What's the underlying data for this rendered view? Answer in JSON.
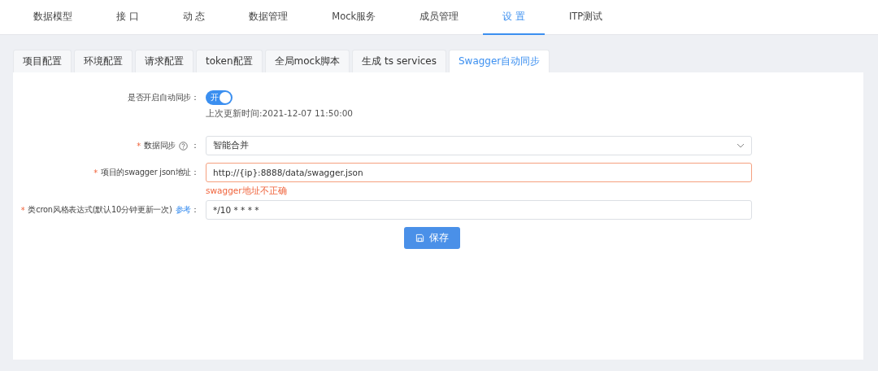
{
  "nav": [
    {
      "label": "数据模型",
      "selected": false
    },
    {
      "label": "接 口",
      "selected": false
    },
    {
      "label": "动 态",
      "selected": false
    },
    {
      "label": "数据管理",
      "selected": false
    },
    {
      "label": "Mock服务",
      "selected": false
    },
    {
      "label": "成员管理",
      "selected": false
    },
    {
      "label": "设 置",
      "selected": true
    },
    {
      "label": "ITP测试",
      "selected": false
    }
  ],
  "subtabs": [
    {
      "label": "项目配置",
      "selected": false
    },
    {
      "label": "环境配置",
      "selected": false
    },
    {
      "label": "请求配置",
      "selected": false
    },
    {
      "label": "token配置",
      "selected": false
    },
    {
      "label": "全局mock脚本",
      "selected": false
    },
    {
      "label": "生成 ts services",
      "selected": false
    },
    {
      "label": "Swagger自动同步",
      "selected": true
    }
  ],
  "form": [
    {
      "kind": "switch",
      "label": "是否开启自动同步：",
      "on": true,
      "switch_text": "开",
      "note": "上次更新时间:2021-12-07 11:50:00"
    },
    {
      "kind": "select",
      "label": "数据同步",
      "help": true,
      "colon": "：",
      "required_mark": "*",
      "value": "智能合并"
    },
    {
      "kind": "input",
      "label": "项目的swagger json地址：",
      "required_mark": "*",
      "value": "http://{ip}:8888/data/swagger.json",
      "error": "swagger地址不正确"
    },
    {
      "kind": "input",
      "label": "类cron风格表达式(默认10分钟更新一次)",
      "link": "参考",
      "colon": "：",
      "required_mark": "*",
      "value": "*/10 * * * *"
    }
  ],
  "save_button": "保存"
}
